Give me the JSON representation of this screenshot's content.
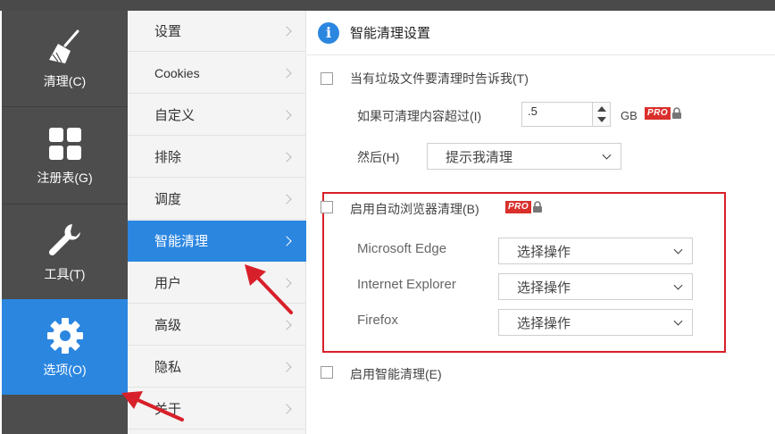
{
  "nav": {
    "items": [
      {
        "id": "clean",
        "label": "清理(C)",
        "icon": "broom-icon",
        "active": false
      },
      {
        "id": "registry",
        "label": "注册表(G)",
        "icon": "grid-icon",
        "active": false
      },
      {
        "id": "tools",
        "label": "工具(T)",
        "icon": "wrench-icon",
        "active": false
      },
      {
        "id": "options",
        "label": "选项(O)",
        "icon": "gear-icon",
        "active": true
      }
    ]
  },
  "menu": {
    "items": [
      {
        "label": "设置"
      },
      {
        "label": "Cookies"
      },
      {
        "label": "自定义"
      },
      {
        "label": "排除"
      },
      {
        "label": "调度"
      },
      {
        "label": "智能清理",
        "active": true
      },
      {
        "label": "用户"
      },
      {
        "label": "高级"
      },
      {
        "label": "隐私"
      },
      {
        "label": "关于"
      }
    ]
  },
  "content": {
    "title": "智能清理设置",
    "notify_label": "当有垃圾文件要清理时告诉我(T)",
    "threshold_label": "如果可清理内容超过(I)",
    "threshold_value": ".5",
    "threshold_unit": "GB",
    "then_label": "然后(H)",
    "then_value": "提示我清理",
    "pro_tag": "PRO",
    "browser_label": "启用自动浏览器清理(B)",
    "browsers": [
      {
        "name": "Microsoft Edge",
        "value": "选择操作"
      },
      {
        "name": "Internet Explorer",
        "value": "选择操作"
      },
      {
        "name": "Firefox",
        "value": "选择操作"
      }
    ],
    "smart_label": "启用智能清理(E)"
  },
  "colors": {
    "accent": "#2b86e0",
    "highlight": "#d8202a",
    "nav_bg": "#4d4d4d"
  }
}
